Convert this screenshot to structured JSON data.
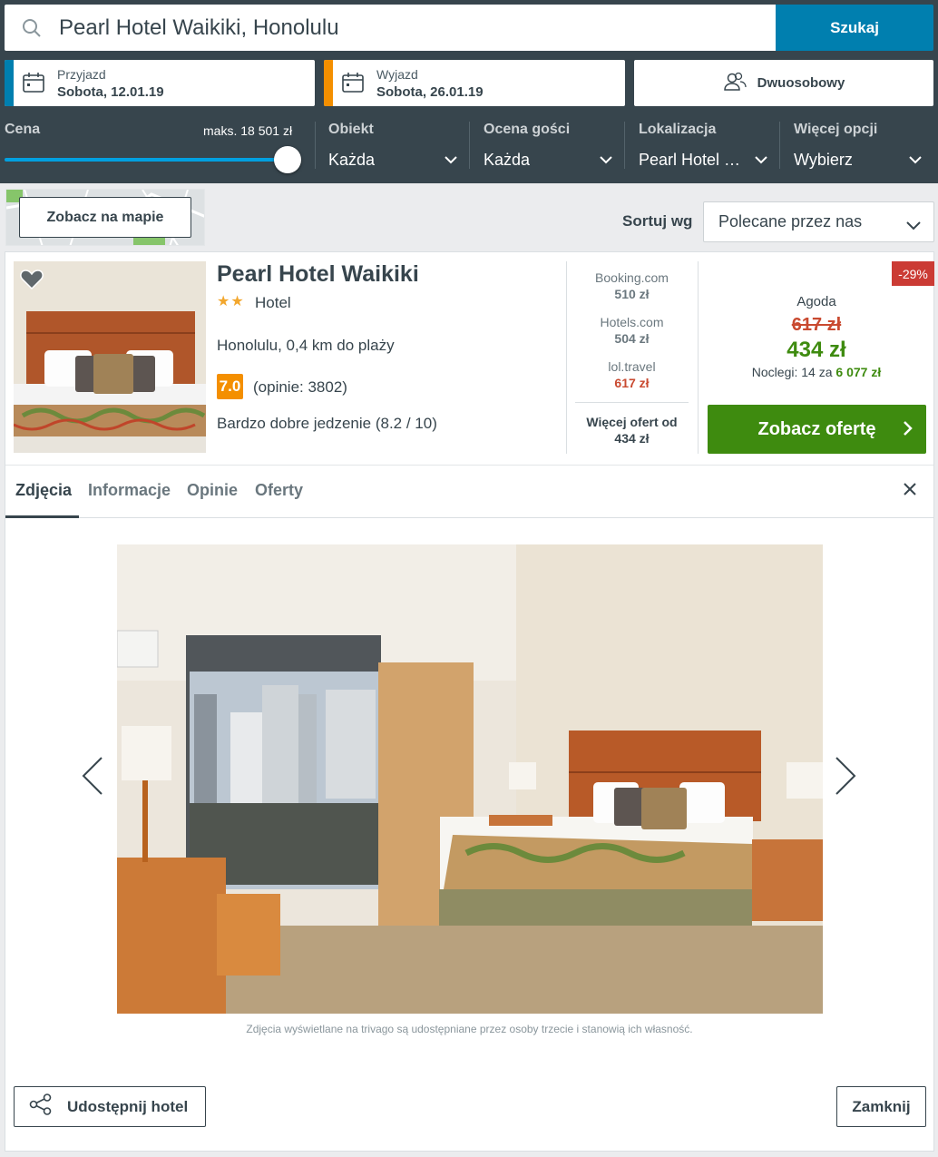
{
  "search": {
    "value": "Pearl Hotel Waikiki, Honolulu",
    "button": "Szukaj"
  },
  "checkin": {
    "label": "Przyjazd",
    "value": "Sobota, 12.01.19"
  },
  "checkout": {
    "label": "Wyjazd",
    "value": "Sobota, 26.01.19"
  },
  "room": {
    "label": "Dwuosobowy"
  },
  "filters": {
    "price": {
      "label": "Cena",
      "max": "maks. 18 501 zł",
      "slider_fraction": 1.0
    },
    "items": [
      {
        "label": "Obiekt",
        "value": "Każda"
      },
      {
        "label": "Ocena gości",
        "value": "Każda"
      },
      {
        "label": "Lokalizacja",
        "value": "Pearl Hotel …"
      },
      {
        "label": "Więcej opcji",
        "value": "Wybierz"
      }
    ]
  },
  "map": {
    "button": "Zobacz na mapie"
  },
  "sort": {
    "label": "Sortuj wg",
    "value": "Polecane przez nas"
  },
  "hotel": {
    "name": "Pearl Hotel Waikiki",
    "stars": "★★",
    "star_count": 2,
    "type": "Hotel",
    "location": "Honolulu, 0,4 km do plaży",
    "rating": "7.0",
    "reviews": "(opinie: 3802)",
    "highlight": "Bardzo dobre jedzenie (8.2 / 10)"
  },
  "alt_deals": [
    {
      "provider": "Booking.com",
      "price": "510 zł"
    },
    {
      "provider": "Hotels.com",
      "price": "504 zł"
    },
    {
      "provider": "lol.travel",
      "price": "617 zł"
    }
  ],
  "more_deals": {
    "line1": "Więcej ofert od",
    "line2": "434 zł"
  },
  "main_deal": {
    "discount": "-29%",
    "provider": "Agoda",
    "old_price": "617 zł",
    "price": "434 zł",
    "nights_prefix": "Noclegi: 14 za ",
    "nights_total": "6 077 zł",
    "cta": "Zobacz ofertę"
  },
  "tabs": [
    "Zdjęcia",
    "Informacje",
    "Opinie",
    "Oferty"
  ],
  "photo": {
    "caption": "Zdjęcia wyświetlane na trivago są udostępniane przez osoby trzecie i stanowią ich własność."
  },
  "footer": {
    "share": "Udostępnij hotel",
    "close": "Zamknij"
  },
  "colors": {
    "accent": "#007faf",
    "deal_green": "#3e8b0f",
    "discount_red": "#cb3b34",
    "rating_orange": "#f48f00",
    "checkin_bar": "#007faf",
    "checkout_bar": "#f48f00"
  },
  "icons": [
    "search-icon",
    "calendar-icon",
    "users-icon",
    "chevron-down-icon",
    "heart-icon",
    "chevron-right-icon",
    "close-icon",
    "share-icon",
    "arrow-left-icon",
    "arrow-right-icon"
  ]
}
